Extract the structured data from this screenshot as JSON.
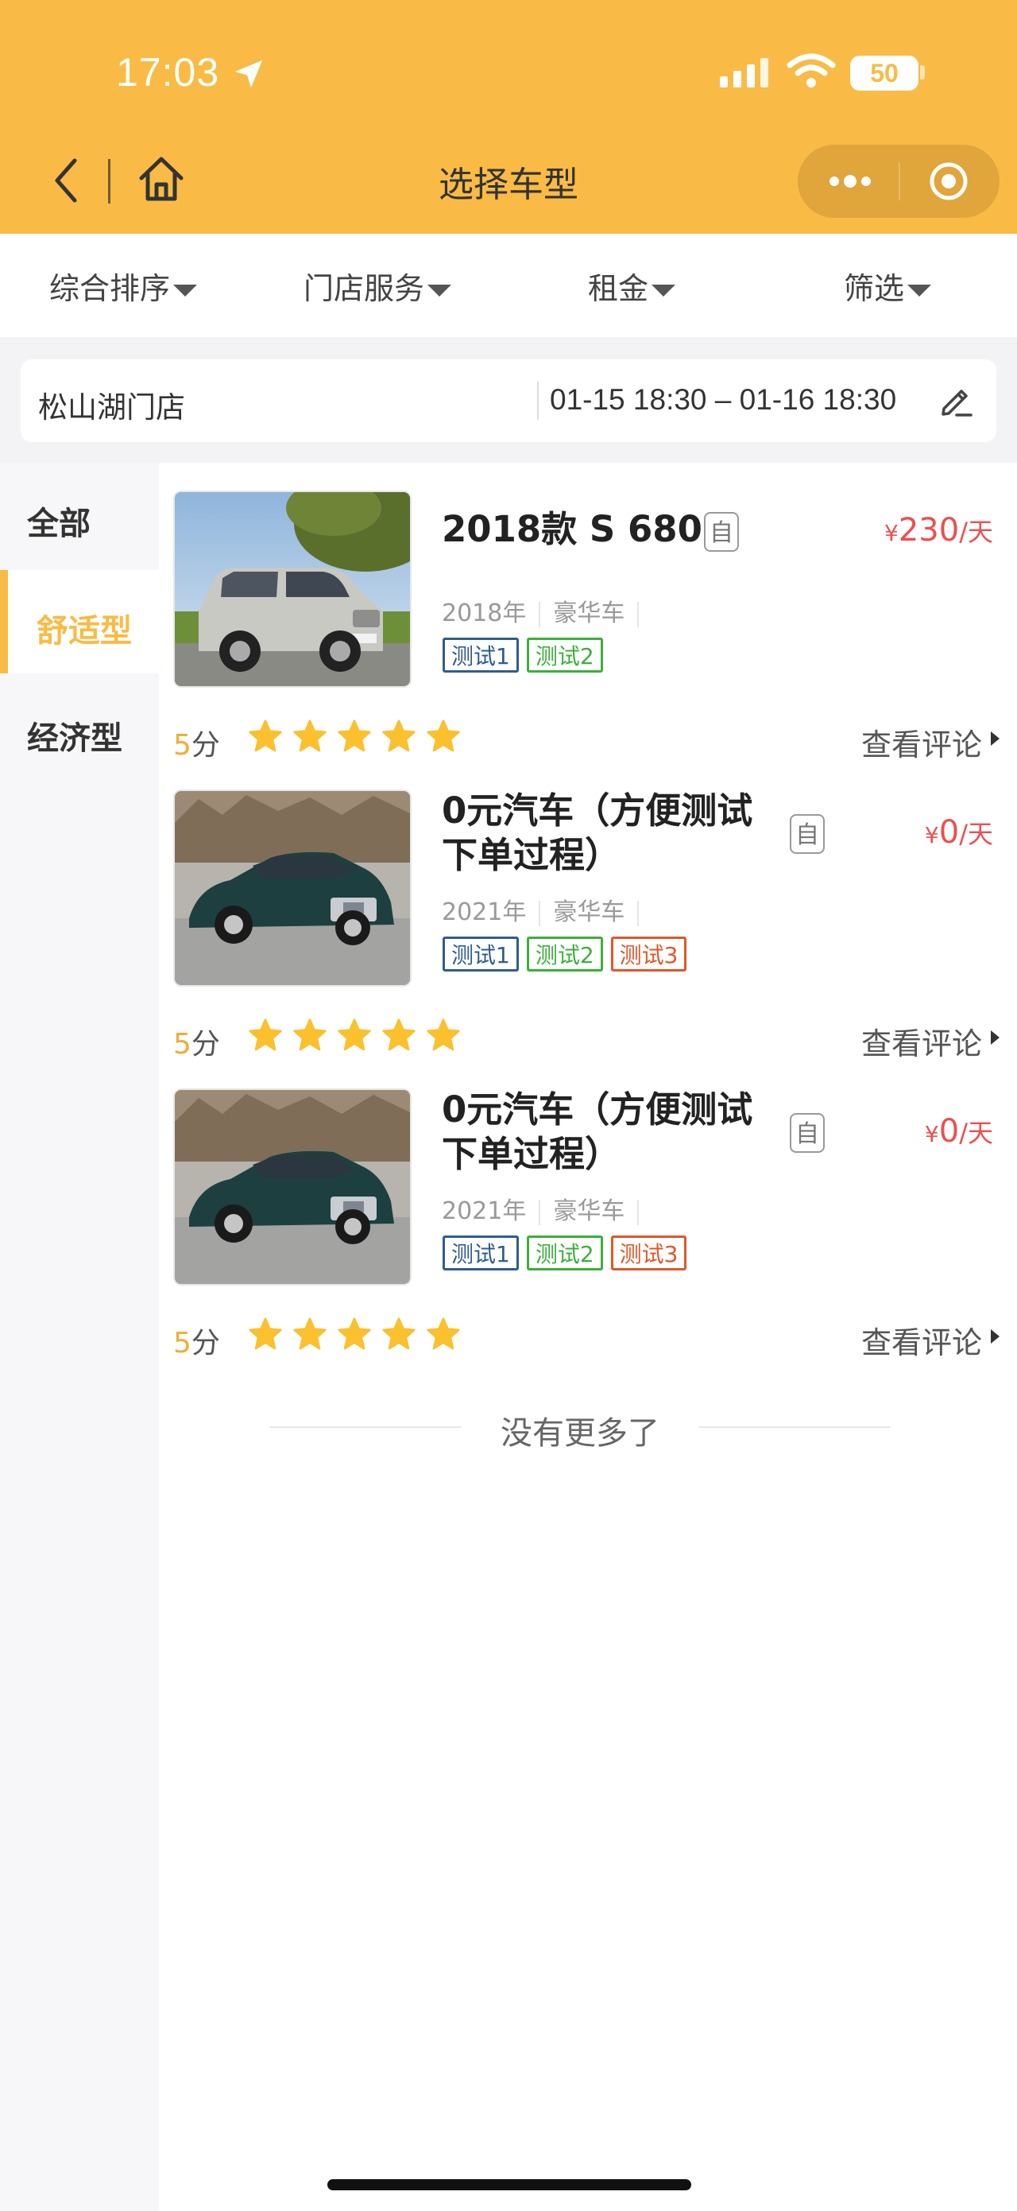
{
  "status_bar": {
    "time": "17:03",
    "battery": "50"
  },
  "header": {
    "title": "选择车型"
  },
  "sort_bar": {
    "items": [
      "综合排序",
      "门店服务",
      "租金",
      "筛选"
    ]
  },
  "store": {
    "name": "松山湖门店",
    "dates": "01-15 18:30 – 01-16 18:30"
  },
  "categories": [
    {
      "label": "全部",
      "active": false
    },
    {
      "label": "舒适型",
      "active": true
    },
    {
      "label": "经济型",
      "active": false
    }
  ],
  "cars": [
    {
      "name": "2018款 S 680",
      "badge": "自",
      "price_currency": "¥",
      "price_value": "230",
      "price_unit": "/天",
      "year": "2018年",
      "car_class": "豪华车",
      "tags": [
        "测试1",
        "测试2"
      ],
      "score_value": "5",
      "score_unit": "分",
      "stars": 5,
      "review_label": "查看评论"
    },
    {
      "name": "0元汽车（方便测试下单过程）",
      "badge": "自",
      "price_currency": "¥",
      "price_value": "0",
      "price_unit": "/天",
      "year": "2021年",
      "car_class": "豪华车",
      "tags": [
        "测试1",
        "测试2",
        "测试3"
      ],
      "score_value": "5",
      "score_unit": "分",
      "stars": 5,
      "review_label": "查看评论"
    },
    {
      "name": "0元汽车（方便测试下单过程）",
      "badge": "自",
      "price_currency": "¥",
      "price_value": "0",
      "price_unit": "/天",
      "year": "2021年",
      "car_class": "豪华车",
      "tags": [
        "测试1",
        "测试2",
        "测试3"
      ],
      "score_value": "5",
      "score_unit": "分",
      "stars": 5,
      "review_label": "查看评论"
    }
  ],
  "footer": {
    "no_more": "没有更多了"
  },
  "colors": {
    "brand": "#f9bb45",
    "price": "#ee4e4e",
    "star": "#fbc02d"
  }
}
